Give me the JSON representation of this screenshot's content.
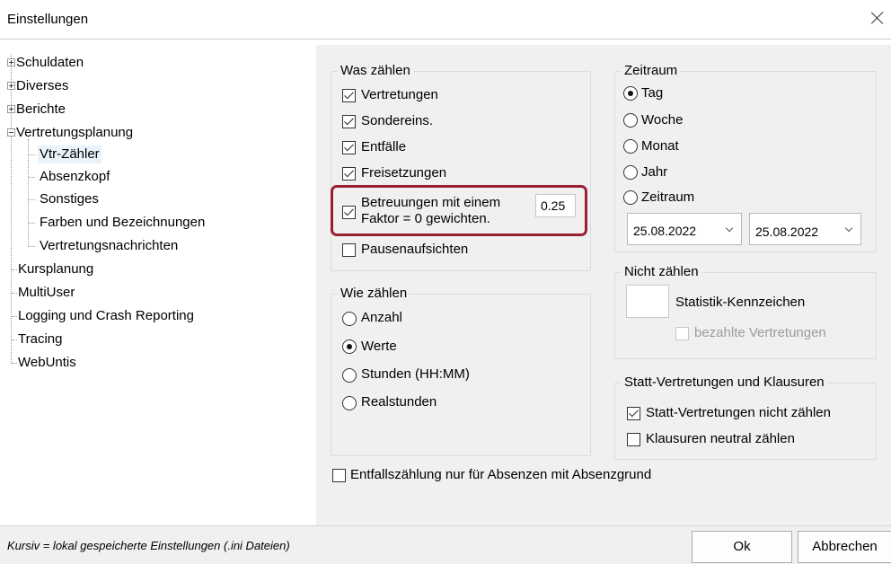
{
  "window": {
    "title": "Einstellungen"
  },
  "tree": {
    "items": [
      {
        "label": "Schuldaten"
      },
      {
        "label": "Diverses"
      },
      {
        "label": "Berichte"
      },
      {
        "label": "Vertretungsplanung"
      },
      {
        "label": "Vtr-Zähler"
      },
      {
        "label": "Absenzkopf"
      },
      {
        "label": "Sonstiges"
      },
      {
        "label": "Farben und Bezeichnungen"
      },
      {
        "label": "Vertretungsnachrichten"
      },
      {
        "label": "Kursplanung"
      },
      {
        "label": "MultiUser"
      },
      {
        "label": "Logging und Crash Reporting"
      },
      {
        "label": "Tracing"
      },
      {
        "label": "WebUntis"
      }
    ]
  },
  "was_zaehlen": {
    "legend": "Was zählen",
    "vertretungen": {
      "label": "Vertretungen",
      "checked": true
    },
    "sondereins": {
      "label": "Sondereins.",
      "checked": true
    },
    "entfaelle": {
      "label": "Entfälle",
      "checked": true
    },
    "freisetzungen": {
      "label": "Freisetzungen",
      "checked": true
    },
    "betreuungen": {
      "label_line1": "Betreuungen mit einem",
      "label_line2": "Faktor = 0 gewichten.",
      "checked": true,
      "factor": "0.25"
    },
    "pausenaufsichten": {
      "label": "Pausenaufsichten",
      "checked": false
    }
  },
  "wie_zaehlen": {
    "legend": "Wie zählen",
    "options": [
      "Anzahl",
      "Werte",
      "Stunden (HH:MM)",
      "Realstunden"
    ],
    "selected": "Werte"
  },
  "zeitraum": {
    "legend": "Zeitraum",
    "options": [
      "Tag",
      "Woche",
      "Monat",
      "Jahr",
      "Zeitraum"
    ],
    "selected": "Tag",
    "from_date": "25.08.2022",
    "to_date": "25.08.2022"
  },
  "nicht_zaehlen": {
    "legend": "Nicht zählen",
    "kennzeichen_label": "Statistik-Kennzeichen",
    "bezahlte": {
      "label": "bezahlte Vertretungen",
      "checked": false,
      "disabled": true
    }
  },
  "statt": {
    "legend": "Statt-Vertretungen und Klausuren",
    "statt_nicht": {
      "label": "Statt-Vertretungen nicht zählen",
      "checked": true
    },
    "klausuren": {
      "label": "Klausuren neutral zählen",
      "checked": false
    }
  },
  "entfall_absenz": {
    "label": "Entfallszählung nur für Absenzen mit Absenzgrund",
    "checked": false
  },
  "statusbar": {
    "hint": "Kursiv = lokal gespeicherte Einstellungen (.ini Dateien)",
    "ok_label": "Ok",
    "cancel_label": "Abbrechen"
  },
  "colors": {
    "highlight_border": "#9a1f33",
    "panel_bg": "#f0f0f0",
    "selection_bg": "#eaf2fc"
  }
}
